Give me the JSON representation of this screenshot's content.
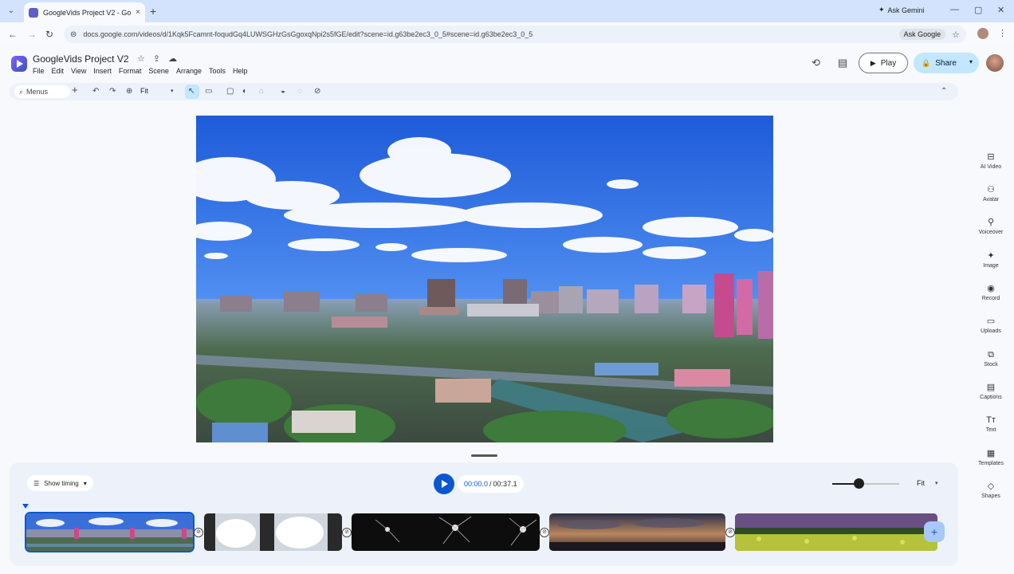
{
  "browser": {
    "tab_title": "GoogleVids Project V2 - Google Vids",
    "tab_close": "×",
    "new_tab": "+",
    "menu_caret": "⌄",
    "gemini_label": "Ask Gemini",
    "window_controls": [
      "—",
      "▢",
      "✕"
    ],
    "nav": {
      "back": "←",
      "forward": "→",
      "reload": "↻",
      "site_info": "⊜"
    },
    "url": "docs.google.com/videos/d/1Kqk5Fcamnt-foqudGq4LUWSGHzGsGgoxqNpi2s5fGE/edit?scene=id.g63be2ec3_0_5#scene=id.g63be2ec3_0_5",
    "ask_google": "Ask Google",
    "bookmark_icon": "☆",
    "more_icon": "⋮"
  },
  "header": {
    "title": "GoogleVids Project V2",
    "title_icons": [
      "☆",
      "⇪",
      "☁"
    ],
    "menus": [
      "File",
      "Edit",
      "View",
      "Insert",
      "Format",
      "Scene",
      "Arrange",
      "Tools",
      "Help"
    ],
    "history_icon": "⟲",
    "comment_icon": "▤",
    "play_icon": "▶",
    "play_label": "Play",
    "share_icon": "🔒",
    "share_label": "Share",
    "share_caret": "▾"
  },
  "toolbar": {
    "search_icon": "⌕",
    "search_label": "Menus",
    "add": "+",
    "undo": "↶",
    "redo": "↷",
    "zoom": "⊕",
    "zoom_value": "Fit",
    "zoom_caret": "▾",
    "select": "↖",
    "comment": "▭",
    "frame": "▢",
    "shape": "◐",
    "paint": "⌂",
    "fill": "◒",
    "border": "◌",
    "link": "⊘",
    "collapse": "⌃"
  },
  "side_panel": [
    {
      "icon": "⊟",
      "label": "AI Video"
    },
    {
      "icon": "⚇",
      "label": "Avatar"
    },
    {
      "icon": "⚲",
      "label": "Voiceover"
    },
    {
      "icon": "✦",
      "label": "Image"
    },
    {
      "icon": "◉",
      "label": "Record"
    },
    {
      "icon": "▭",
      "label": "Uploads"
    },
    {
      "icon": "⧉",
      "label": "Stock"
    },
    {
      "icon": "▤",
      "label": "Captions"
    },
    {
      "icon": "Tт",
      "label": "Text"
    },
    {
      "icon": "▦",
      "label": "Templates"
    },
    {
      "icon": "◇",
      "label": "Shapes"
    }
  ],
  "timeline": {
    "show_timing_icon": "☰",
    "show_timing_label": "Show timing",
    "show_timing_caret": "▾",
    "current_time": "00:00.0",
    "separator": "/",
    "total_time": "00:37.1",
    "zoom_level": 0.4,
    "fit_label": "Fit",
    "fit_caret": "▾",
    "transition_icon": "⊘",
    "add_scene": "+",
    "scenes": [
      {
        "name": "City skyline",
        "selected": true
      },
      {
        "name": "Waterfall",
        "selected": false
      },
      {
        "name": "Sparkler",
        "selected": false
      },
      {
        "name": "Sunset",
        "selected": false
      },
      {
        "name": "Flower field",
        "selected": false
      }
    ]
  },
  "colors": {
    "accent": "#0b57d0",
    "share_bg": "#c2e7ff",
    "tabbar": "#d3e3fd"
  }
}
